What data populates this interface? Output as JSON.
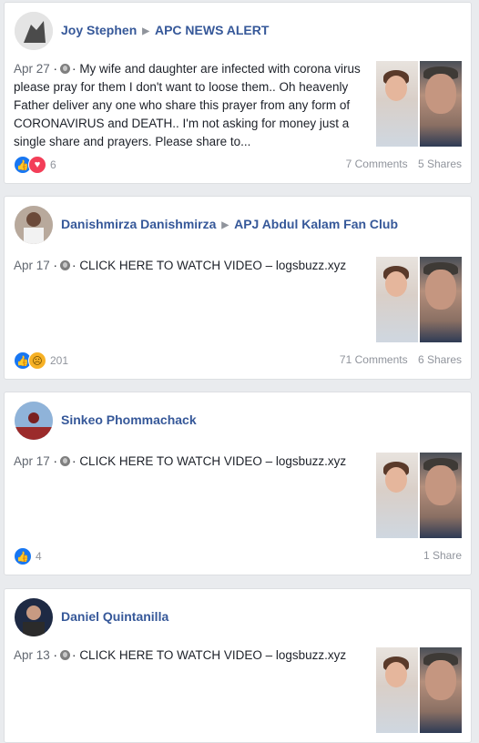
{
  "posts": [
    {
      "author": "Joy Stephen",
      "group": "APC NEWS ALERT",
      "date": "Apr 27",
      "text": "My wife and daughter are infected with corona virus please pray for them I don't want to loose them.. Oh heavenly Father deliver any one who share this prayer from any form of CORONAVIRUS and DEATH.. I'm not asking for money just a single share and prayers. Please share to...",
      "reaction_count": "6",
      "comments": "7 Comments",
      "shares": "5 Shares",
      "reactions": [
        "like-icon",
        "love-icon"
      ]
    },
    {
      "author": "Danishmirza Danishmirza",
      "group": "APJ Abdul Kalam Fan Club",
      "date": "Apr 17",
      "text": "CLICK HERE TO WATCH VIDEO – logsbuzz.xyz",
      "reaction_count": "201",
      "comments": "71 Comments",
      "shares": "6 Shares",
      "reactions": [
        "like-icon",
        "sad-icon"
      ]
    },
    {
      "author": "Sinkeo Phommachack",
      "group": "",
      "date": "Apr 17",
      "text": "CLICK HERE TO WATCH VIDEO – logsbuzz.xyz",
      "reaction_count": "4",
      "comments": "",
      "shares": "1 Share",
      "reactions": [
        "like-icon"
      ]
    },
    {
      "author": "Daniel Quintanilla",
      "group": "",
      "date": "Apr 13",
      "text": "CLICK HERE TO WATCH VIDEO – logsbuzz.xyz",
      "reaction_count": "",
      "comments": "",
      "shares": "",
      "reactions": []
    }
  ],
  "separator": "·",
  "colors": {
    "link": "#365899",
    "background": "#e9ebee",
    "muted": "#90949c"
  }
}
